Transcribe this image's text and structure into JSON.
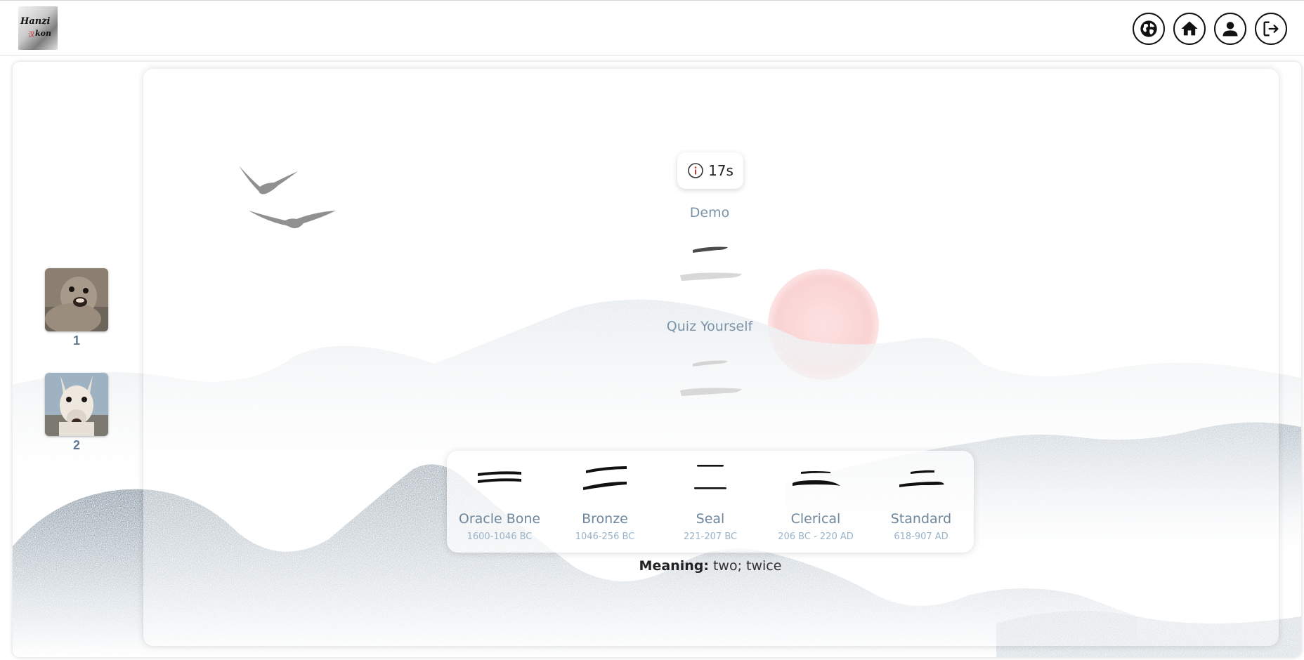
{
  "header": {
    "logo_text_top": "Hanzi",
    "logo_text_bottom": "kon",
    "nav": [
      {
        "name": "language-button",
        "icon": "globe-icon"
      },
      {
        "name": "home-button",
        "icon": "home-icon"
      },
      {
        "name": "profile-button",
        "icon": "user-icon"
      },
      {
        "name": "logout-button",
        "icon": "logout-icon"
      }
    ]
  },
  "players": [
    {
      "rank": "1",
      "avatar": "seal"
    },
    {
      "rank": "2",
      "avatar": "llama"
    }
  ],
  "timer": {
    "value": "17s",
    "icon": "info-icon"
  },
  "demo_label": "Demo",
  "quiz_label": "Quiz Yourself",
  "character": "二",
  "scripts": [
    {
      "name": "Oracle Bone",
      "era": "1600-1046 BC"
    },
    {
      "name": "Bronze",
      "era": "1046-256 BC"
    },
    {
      "name": "Seal",
      "era": "221-207 BC"
    },
    {
      "name": "Clerical",
      "era": "206 BC - 220 AD"
    },
    {
      "name": "Standard",
      "era": "618-907 AD"
    }
  ],
  "meaning": {
    "label": "Meaning:",
    "value": "two; twice"
  },
  "colors": {
    "accent_text": "#7a93a8",
    "sun": "#f9c2c2",
    "mountain_dark": "#7b8d9c",
    "mountain_light": "#d9e0e4"
  }
}
